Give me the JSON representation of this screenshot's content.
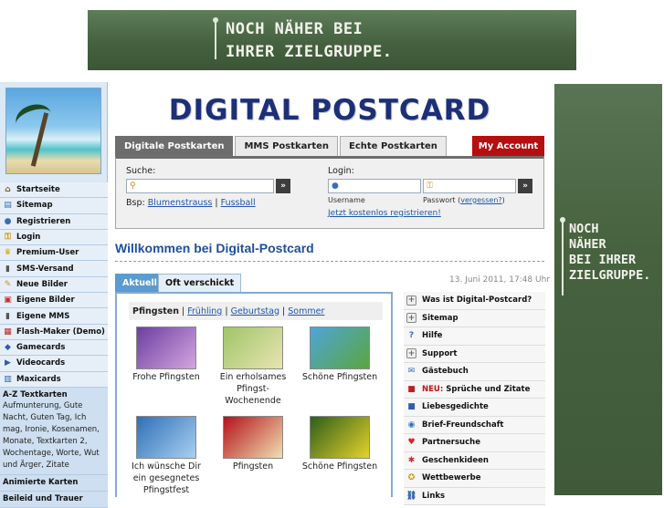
{
  "top_banner": {
    "line1": "NOCH NÄHER BEI",
    "line2": "IHRER ZIELGRUPPE."
  },
  "side_banner": {
    "lines": [
      "NOCH",
      "NÄHER",
      "BEI IHRER",
      "ZIELGRUPPE."
    ]
  },
  "logo": "DIGITAL POSTCARD",
  "sidebar": {
    "items": [
      {
        "label": "Startseite",
        "icon": "home-icon",
        "glyph": "⌂",
        "color": "#7a5a2a"
      },
      {
        "label": "Sitemap",
        "icon": "sitemap-icon",
        "glyph": "▤",
        "color": "#3b6db3"
      },
      {
        "label": "Registrieren",
        "icon": "user-icon",
        "glyph": "●",
        "color": "#3b6db3"
      },
      {
        "label": "Login",
        "icon": "key-icon",
        "glyph": "⚿",
        "color": "#c99a1c"
      },
      {
        "label": "Premium-User",
        "icon": "crown-icon",
        "glyph": "♛",
        "color": "#d9a300"
      },
      {
        "label": "SMS-Versand",
        "icon": "phone-icon",
        "glyph": "▮",
        "color": "#555"
      },
      {
        "label": "Neue Bilder",
        "icon": "pencil-icon",
        "glyph": "✎",
        "color": "#c89320"
      },
      {
        "label": "Eigene Bilder",
        "icon": "image-icon",
        "glyph": "▣",
        "color": "#c03030"
      },
      {
        "label": "Eigene MMS",
        "icon": "phone-icon",
        "glyph": "▮",
        "color": "#555"
      },
      {
        "label": "Flash-Maker (Demo)",
        "icon": "film-icon",
        "glyph": "▦",
        "color": "#b22"
      },
      {
        "label": "Gamecards",
        "icon": "gamepad-icon",
        "glyph": "◆",
        "color": "#2b5fa8"
      },
      {
        "label": "Videocards",
        "icon": "video-icon",
        "glyph": "▶",
        "color": "#2b5fa8"
      },
      {
        "label": "Maxicards",
        "icon": "cards-icon",
        "glyph": "▥",
        "color": "#2b5fa8"
      }
    ],
    "az_section": {
      "title": "A-Z Textkarten",
      "links": "Aufmunterung, Gute Nacht, Guten Tag, Ich mag, Ironie, Kosenamen, Monate, Textkarten 2, Wochentage, Worte, Wut und Ärger, Zitate"
    },
    "animated": "Animierte Karten",
    "partial": "Beileid und Trauer"
  },
  "tabs": [
    "Digitale Postkarten",
    "MMS Postkarten",
    "Echte Postkarten"
  ],
  "my_account": "My Account",
  "search": {
    "label": "Suche:",
    "go": "»",
    "examples_prefix": "Bsp:",
    "example1": "Blumenstrauss",
    "separator": "|",
    "example2": "Fussball"
  },
  "login": {
    "label": "Login:",
    "username": "Username",
    "password": "Passwort",
    "forgot": "vergessen?",
    "go": "»",
    "register": "Jetzt kostenlos registrieren!"
  },
  "welcome": "Willkommen bei Digital-Postcard",
  "date": "13. Juni 2011, 17:48 Uhr",
  "content_tabs": [
    "Aktuell",
    "Oft verschickt"
  ],
  "categories": {
    "active": "Pfingsten",
    "links": [
      "Frühling",
      "Geburtstag",
      "Sommer"
    ],
    "separator": "|"
  },
  "cards": [
    {
      "caption": "Frohe Pfingsten",
      "colors": [
        "#6b3fa0",
        "#d4a5e0"
      ]
    },
    {
      "caption": "Ein erholsames Pfingst-Wochenende",
      "colors": [
        "#9fc56a",
        "#e8e4b0"
      ]
    },
    {
      "caption": "Schöne Pfingsten",
      "colors": [
        "#4ea5d8",
        "#5aa63c"
      ]
    },
    {
      "caption": "Ich wünsche Dir ein gesegnetes Pfingstfest",
      "colors": [
        "#2f6fb8",
        "#a8d0ef"
      ]
    },
    {
      "caption": "Pfingsten",
      "colors": [
        "#b3121b",
        "#f0e0b0"
      ]
    },
    {
      "caption": "Schöne Pfingsten",
      "colors": [
        "#2d5e1a",
        "#e6d22a"
      ]
    }
  ],
  "right_links": [
    {
      "label": "Was ist Digital-Postcard?",
      "icon": "plus-icon",
      "glyph": "+",
      "color": "#666"
    },
    {
      "label": "Sitemap",
      "icon": "plus-icon",
      "glyph": "+",
      "color": "#666"
    },
    {
      "label": "Hilfe",
      "icon": "help-icon",
      "glyph": "?",
      "color": "#2b6fc0"
    },
    {
      "label": "Support",
      "icon": "plus-icon",
      "glyph": "+",
      "color": "#666"
    },
    {
      "label": "Gästebuch",
      "icon": "speech-icon",
      "glyph": "✉",
      "color": "#2b6fc0"
    },
    {
      "label": "Sprüche und Zitate",
      "prefix": "NEU:",
      "icon": "book-icon",
      "glyph": "■",
      "color": "#b22"
    },
    {
      "label": "Liebesgedichte",
      "icon": "book-icon",
      "glyph": "■",
      "color": "#2b5fa8"
    },
    {
      "label": "Brief-Freundschaft",
      "icon": "globe-icon",
      "glyph": "◉",
      "color": "#2b6fc0"
    },
    {
      "label": "Partnersuche",
      "icon": "heart-icon",
      "glyph": "♥",
      "color": "#d22"
    },
    {
      "label": "Geschenkideen",
      "icon": "gift-icon",
      "glyph": "✱",
      "color": "#c03030"
    },
    {
      "label": "Wettbewerbe",
      "icon": "trophy-icon",
      "glyph": "✪",
      "color": "#d29a00"
    },
    {
      "label": "Links",
      "icon": "link-icon",
      "glyph": "⛓",
      "color": "#2b5fa8"
    }
  ]
}
